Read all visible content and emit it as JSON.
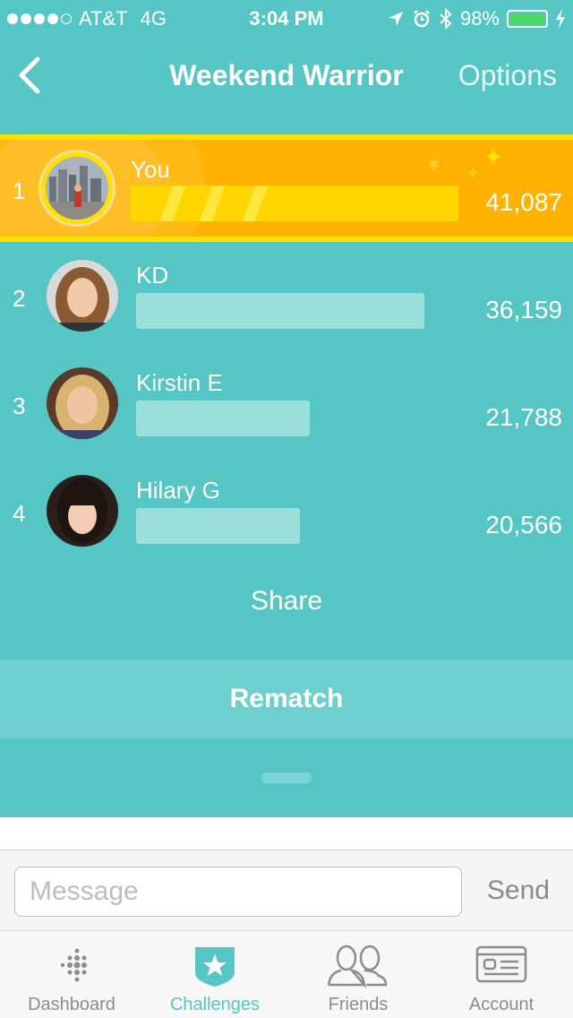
{
  "status_bar": {
    "carrier": "AT&T",
    "network": "4G",
    "time": "3:04 PM",
    "battery": "98%",
    "battery_level": 0.98
  },
  "nav": {
    "title": "Weekend Warrior",
    "options_label": "Options"
  },
  "leaderboard": [
    {
      "rank": "1",
      "name": "You",
      "score": "41,087",
      "progress": 1.0
    },
    {
      "rank": "2",
      "name": "KD",
      "score": "36,159",
      "progress": 0.88
    },
    {
      "rank": "3",
      "name": "Kirstin E",
      "score": "21,788",
      "progress": 0.53
    },
    {
      "rank": "4",
      "name": "Hilary G",
      "score": "20,566",
      "progress": 0.5
    }
  ],
  "actions": {
    "share_label": "Share",
    "rematch_label": "Rematch"
  },
  "message": {
    "placeholder": "Message",
    "send_label": "Send"
  },
  "tabs": [
    {
      "label": "Dashboard",
      "icon": "fitbit-dots-icon"
    },
    {
      "label": "Challenges",
      "icon": "star-badge-icon",
      "active": true
    },
    {
      "label": "Friends",
      "icon": "people-icon"
    },
    {
      "label": "Account",
      "icon": "id-card-icon"
    }
  ],
  "colors": {
    "accent": "#55c6c4",
    "leader_highlight": "#ffb300",
    "leader_bar": "#ffd600"
  }
}
